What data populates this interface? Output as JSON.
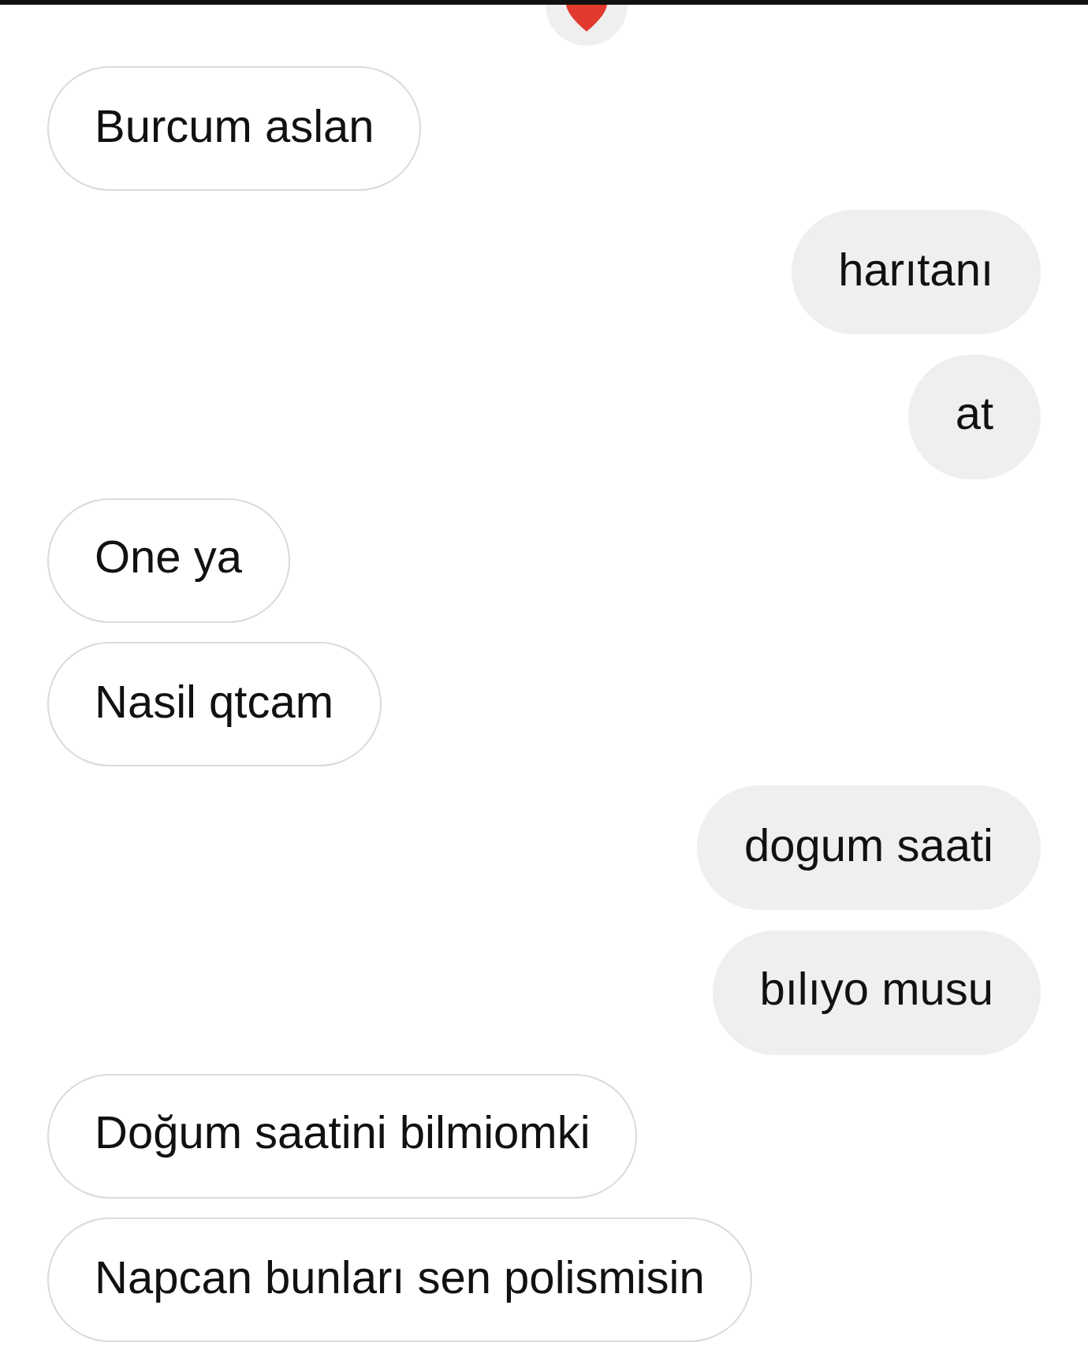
{
  "top_reaction": {
    "kind": "heart"
  },
  "messages": [
    {
      "kind": "received",
      "text": "Burcum aslan"
    },
    {
      "kind": "sent",
      "text": "harıtanı"
    },
    {
      "kind": "sent",
      "text": "at"
    },
    {
      "kind": "received",
      "text": "One ya"
    },
    {
      "kind": "received",
      "text": "Nasil qtcam"
    },
    {
      "kind": "sent",
      "text": "dogum saati"
    },
    {
      "kind": "sent",
      "text": "bılıyo musu"
    },
    {
      "kind": "received",
      "text": "Doğum saatini bilmiomki"
    },
    {
      "kind": "received",
      "text": "Napcan bunları sen polismisin"
    }
  ]
}
